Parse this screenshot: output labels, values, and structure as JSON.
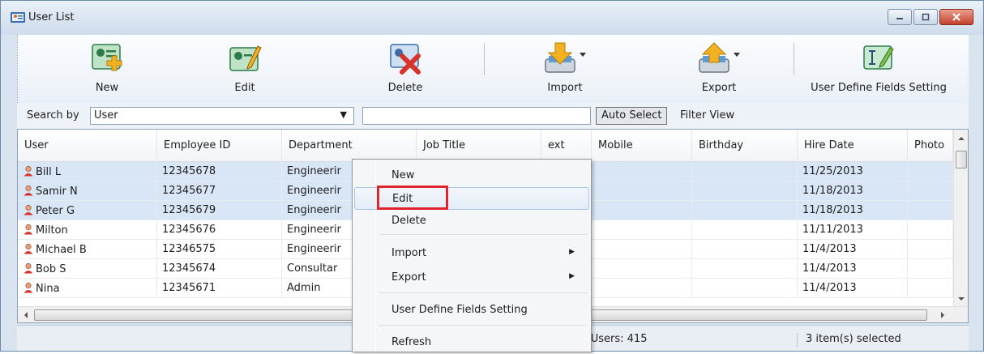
{
  "window": {
    "title": "User List",
    "controls": {
      "minimize": "minimize",
      "maximize": "maximize",
      "close": "close"
    }
  },
  "toolbar": {
    "buttons": [
      {
        "label": "New",
        "icon": "user-add-icon"
      },
      {
        "label": "Edit",
        "icon": "user-edit-icon"
      },
      {
        "label": "Delete",
        "icon": "user-delete-icon"
      },
      {
        "label": "Import",
        "icon": "import-icon"
      },
      {
        "label": "Export",
        "icon": "export-icon"
      },
      {
        "label": "User Define Fields Setting",
        "icon": "field-settings-icon"
      }
    ]
  },
  "search": {
    "label": "Search by",
    "field_value": "User",
    "query": "",
    "auto_select_label": "Auto Select",
    "filter_view_label": "Filter View"
  },
  "grid": {
    "columns": [
      "User",
      "Employee ID",
      "Department",
      "Job Title",
      "ext",
      "Mobile",
      "Birthday",
      "Hire Date",
      "Photo"
    ],
    "rows": [
      {
        "user": "Bill L",
        "employee_id": "12345678",
        "department": "Engineerir",
        "hire_date": "11/25/2013",
        "selected": true
      },
      {
        "user": "Samir N",
        "employee_id": "12345677",
        "department": "Engineerir",
        "hire_date": "11/18/2013",
        "selected": true
      },
      {
        "user": "Peter G",
        "employee_id": "12345679",
        "department": "Engineerir",
        "hire_date": "11/18/2013",
        "selected": true
      },
      {
        "user": "Milton",
        "employee_id": "12345676",
        "department": "Engineerir",
        "hire_date": "11/11/2013",
        "selected": false
      },
      {
        "user": "Michael B",
        "employee_id": "12346575",
        "department": "Engineerir",
        "hire_date": "11/4/2013",
        "selected": false
      },
      {
        "user": "Bob S",
        "employee_id": "12345674",
        "department": "Consultar",
        "hire_date": "11/4/2013",
        "selected": false
      },
      {
        "user": "Nina",
        "employee_id": "12345671",
        "department": "Admin",
        "hire_date": "11/4/2013",
        "selected": false
      }
    ]
  },
  "status": {
    "total_users": "l Users: 415",
    "selected": "3 item(s) selected"
  },
  "context_menu": {
    "items": [
      "New",
      "Edit",
      "Delete",
      "Import",
      "Export",
      "User Define Fields Setting",
      "Refresh"
    ],
    "highlighted": "Edit"
  },
  "colors": {
    "selection_row": "#d8e6f6",
    "highlight_box": "#e0242c",
    "window_frame": "#d9e4f1"
  }
}
